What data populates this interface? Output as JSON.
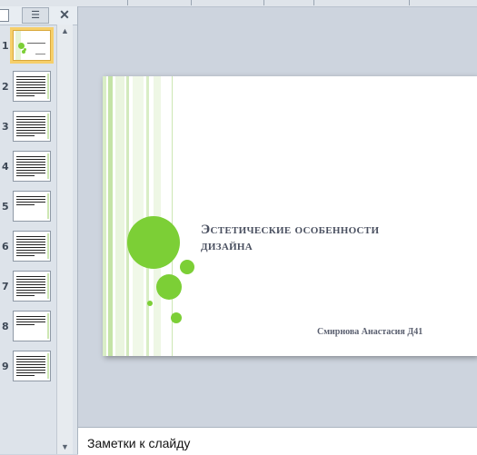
{
  "slides_pane": {
    "outline_tab_icon": "outline-list-icon",
    "close_icon": "close-icon",
    "thumbnails": [
      {
        "number": "1"
      },
      {
        "number": "2"
      },
      {
        "number": "3"
      },
      {
        "number": "4"
      },
      {
        "number": "5"
      },
      {
        "number": "6"
      },
      {
        "number": "7"
      },
      {
        "number": "8"
      },
      {
        "number": "9"
      }
    ],
    "selected": 1
  },
  "slide": {
    "title_line1": "Эстетические особенности",
    "title_line2": "дизайна",
    "subtitle": "Смирнова Анастасия Д41",
    "accent": "#7ccf36"
  },
  "notes": {
    "placeholder": "Заметки к слайду"
  }
}
